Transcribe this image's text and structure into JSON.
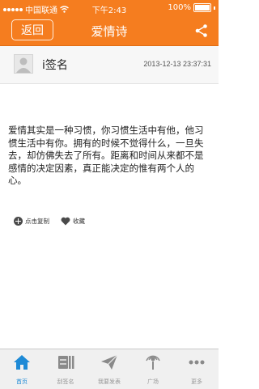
{
  "status_bar": {
    "carrier": "中国联通",
    "time": "下午2:43",
    "battery": "100%"
  },
  "nav": {
    "back_label": "返回",
    "title": "爱情诗"
  },
  "author": {
    "name": "i签名",
    "time": "2013-12-13 23:37:31"
  },
  "post": {
    "body": "爱情其实是一种习惯，你习惯生活中有他，他习惯生活中有你。拥有的时候不觉得什么，一旦失去，却仿佛失去了所有。距离和时间从来都不是感情的决定因素，真正能决定的惟有两个人的心。"
  },
  "actions": {
    "copy_label": "点击复制",
    "favorite_label": "收藏"
  },
  "tabs": [
    {
      "label": "首页",
      "icon": "home-icon",
      "active": true
    },
    {
      "label": "刮签名",
      "icon": "scratch-icon",
      "active": false
    },
    {
      "label": "我要发表",
      "icon": "send-icon",
      "active": false
    },
    {
      "label": "广场",
      "icon": "plaza-icon",
      "active": false
    },
    {
      "label": "更多",
      "icon": "more-icon",
      "active": false
    }
  ],
  "colors": {
    "accent": "#f57d1f",
    "tab_active": "#1e8ad6",
    "tab_inactive": "#9a9a9a"
  }
}
